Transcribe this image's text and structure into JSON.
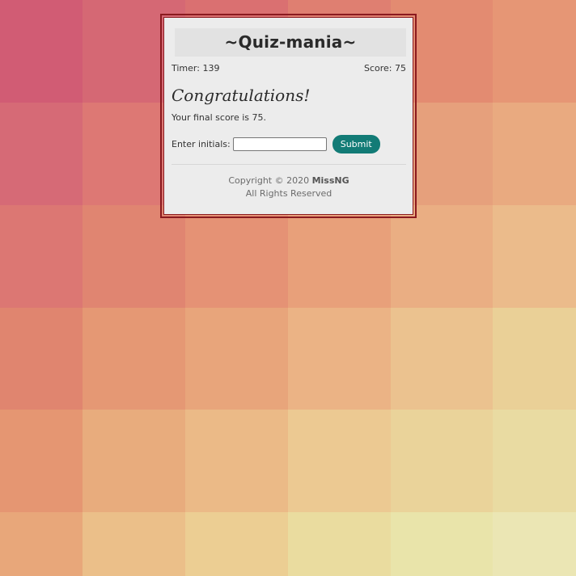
{
  "background": {
    "colors": [
      [
        "#d15c74",
        "#d56874",
        "#da7071",
        "#df7f71",
        "#e38b71",
        "#e69675"
      ],
      [
        "#d66a76",
        "#dd7874",
        "#e18574",
        "#e69373",
        "#e6a07c",
        "#e9aa80"
      ],
      [
        "#dc7773",
        "#e08571",
        "#e59275",
        "#e8a07a",
        "#eaae83",
        "#ebbb8b"
      ],
      [
        "#e0856f",
        "#e59874",
        "#e8a57b",
        "#ebb385",
        "#ebc28f",
        "#ead097"
      ],
      [
        "#e59672",
        "#e8ac7d",
        "#ebba87",
        "#ecc992",
        "#ead39a",
        "#e9dba2"
      ],
      [
        "#e8a77a",
        "#ebbf89",
        "#ecce93",
        "#eadc9f",
        "#e9e4aa",
        "#ebe6b4"
      ]
    ]
  },
  "quiz": {
    "title": "~Quiz-mania~",
    "timer": "Timer: 139",
    "score": "Score: 75",
    "congrats": "Congratulations!",
    "final_score": "Your final score is 75.",
    "initials_label": "Enter initials:",
    "initials_value": "",
    "submit_label": "Submit"
  },
  "footer": {
    "copyright_prefix": "Copyright © 2020 ",
    "author": "MissNG",
    "rights": "All Rights Reserved"
  }
}
